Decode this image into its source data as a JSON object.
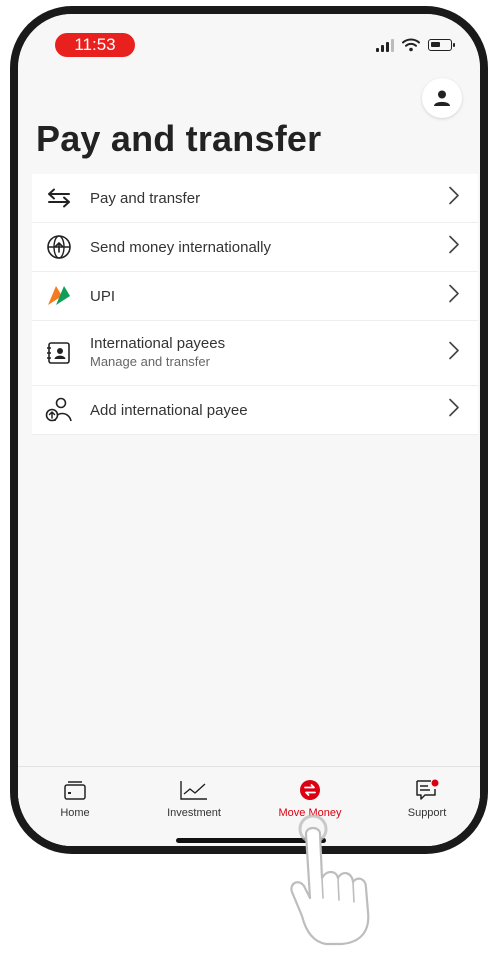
{
  "status_bar": {
    "time": "11:53"
  },
  "header": {
    "title": "Pay and transfer"
  },
  "menu": {
    "items": [
      {
        "label": "Pay and transfer",
        "icon": "arrows-swap-icon"
      },
      {
        "label": "Send money internationally",
        "icon": "globe-icon"
      },
      {
        "label": "UPI",
        "icon": "upi-logo-icon"
      },
      {
        "label": "International payees",
        "sublabel": "Manage and transfer",
        "icon": "contact-card-icon"
      },
      {
        "label": "Add international payee",
        "icon": "add-payee-icon"
      }
    ]
  },
  "bottom_nav": {
    "items": [
      {
        "label": "Home",
        "icon": "wallet-icon"
      },
      {
        "label": "Investment",
        "icon": "chart-line-icon"
      },
      {
        "label": "Move Money",
        "icon": "move-money-icon",
        "active": true
      },
      {
        "label": "Support",
        "icon": "chat-support-icon"
      }
    ]
  },
  "colors": {
    "accent": "#db0011",
    "time_pill": "#e8211f"
  }
}
